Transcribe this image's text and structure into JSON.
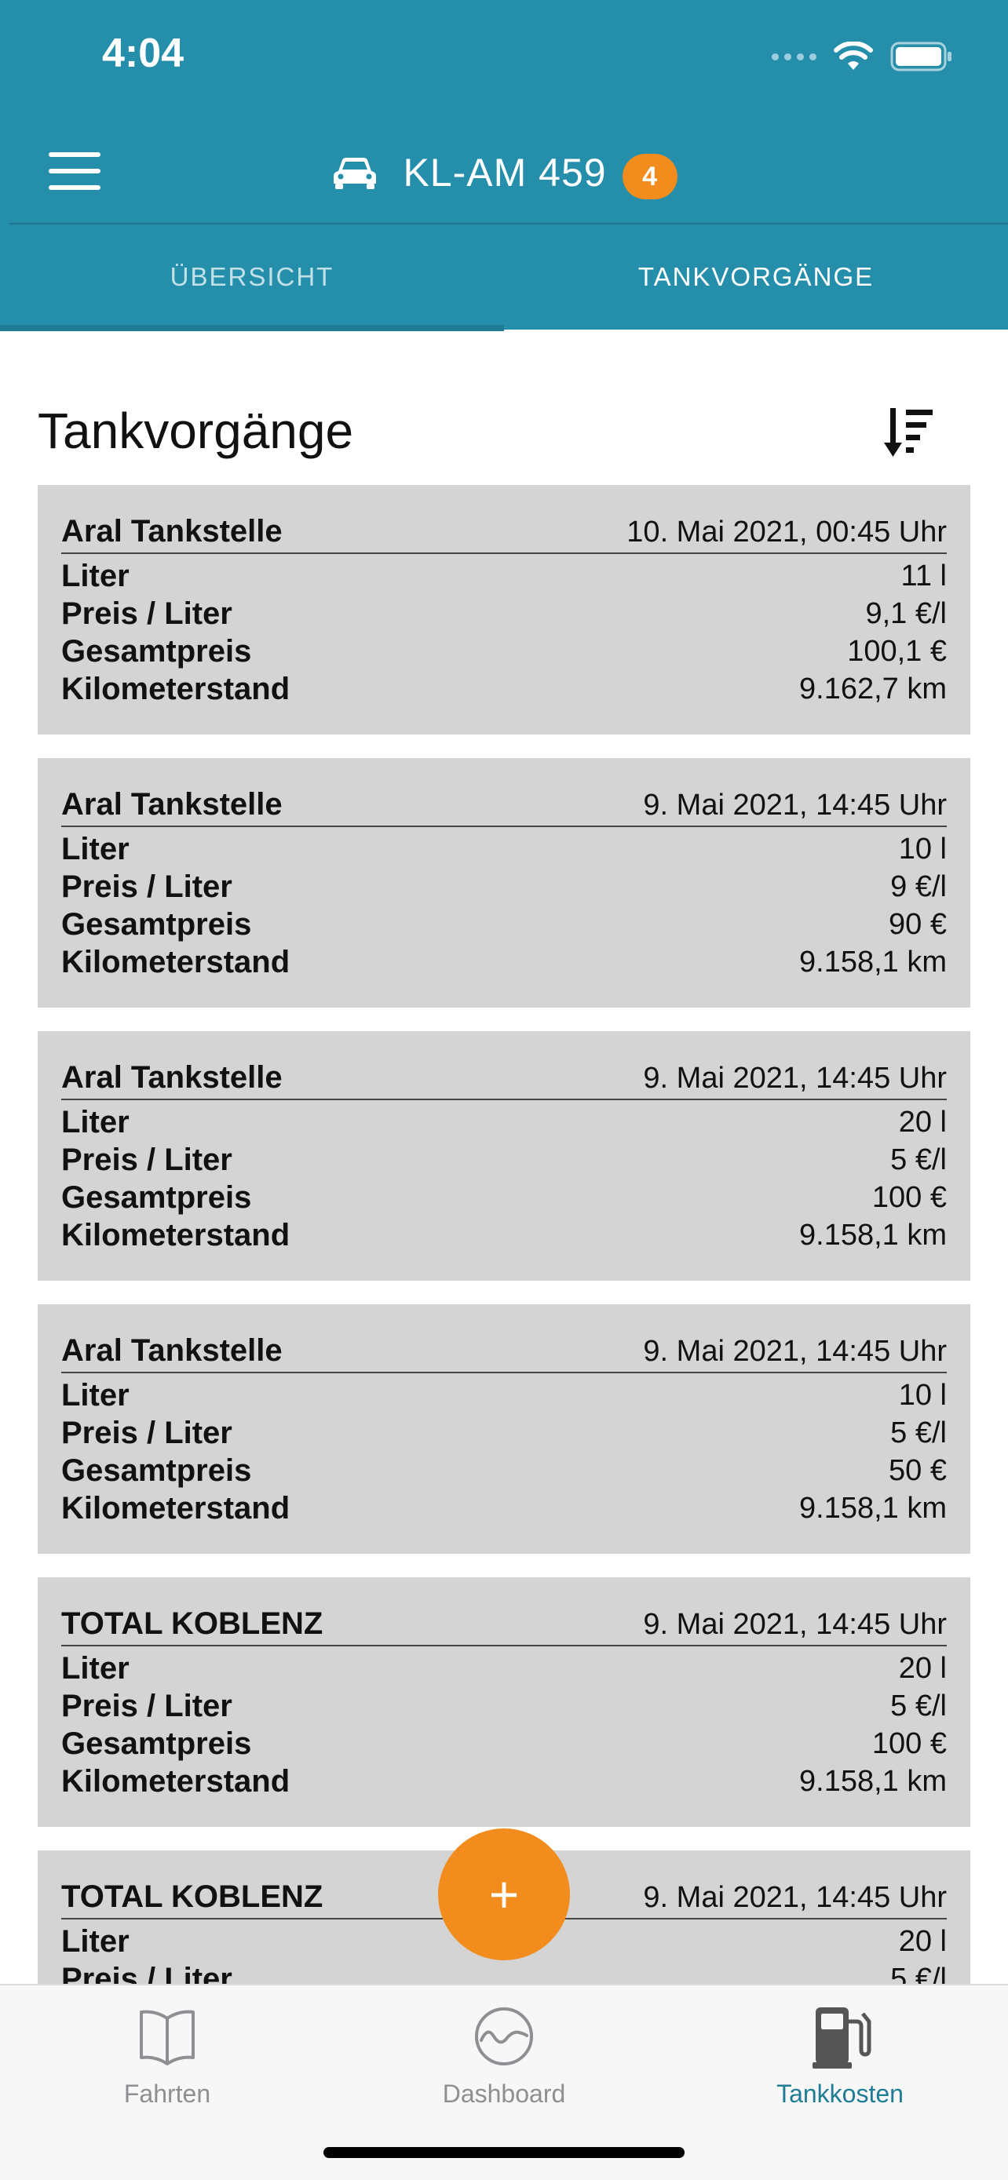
{
  "status_bar": {
    "time": "4:04"
  },
  "header": {
    "vehicle_plate": "KL-AM 459",
    "badge_count": "4",
    "tabs": [
      {
        "label": "ÜBERSICHT",
        "active": false
      },
      {
        "label": "TANKVORGÄNGE",
        "active": true
      }
    ]
  },
  "main": {
    "title": "Tankvorgänge",
    "labels": {
      "liter": "Liter",
      "price_per_liter": "Preis / Liter",
      "total_price": "Gesamtpreis",
      "odometer": "Kilometerstand"
    },
    "entries": [
      {
        "station": "Aral Tankstelle",
        "datetime": "10. Mai 2021, 00:45 Uhr",
        "liter": "11 l",
        "price_per_liter": "9,1 €/l",
        "total_price": "100,1 €",
        "odometer": "9.162,7 km"
      },
      {
        "station": "Aral Tankstelle",
        "datetime": "9. Mai 2021, 14:45 Uhr",
        "liter": "10 l",
        "price_per_liter": "9 €/l",
        "total_price": "90 €",
        "odometer": "9.158,1 km"
      },
      {
        "station": "Aral Tankstelle",
        "datetime": "9. Mai 2021, 14:45 Uhr",
        "liter": "20 l",
        "price_per_liter": "5 €/l",
        "total_price": "100 €",
        "odometer": "9.158,1 km"
      },
      {
        "station": "Aral Tankstelle",
        "datetime": "9. Mai 2021, 14:45 Uhr",
        "liter": "10 l",
        "price_per_liter": "5 €/l",
        "total_price": "50 €",
        "odometer": "9.158,1 km"
      },
      {
        "station": "TOTAL KOBLENZ",
        "datetime": "9. Mai 2021, 14:45 Uhr",
        "liter": "20 l",
        "price_per_liter": "5 €/l",
        "total_price": "100 €",
        "odometer": "9.158,1 km"
      },
      {
        "station": "TOTAL KOBLENZ",
        "datetime": "9. Mai 2021, 14:45 Uhr",
        "liter": "20 l",
        "price_per_liter": "5 €/l"
      }
    ],
    "fab_label": "+"
  },
  "bottom_nav": {
    "items": [
      {
        "label": "Fahrten",
        "icon": "book-icon",
        "active": false
      },
      {
        "label": "Dashboard",
        "icon": "gauge-icon",
        "active": false
      },
      {
        "label": "Tankkosten",
        "icon": "fuel-pump-icon",
        "active": true
      }
    ]
  },
  "colors": {
    "header": "#258fab",
    "accent": "#f28c1c",
    "card": "#d4d4d4",
    "active_nav": "#1f7c95"
  }
}
